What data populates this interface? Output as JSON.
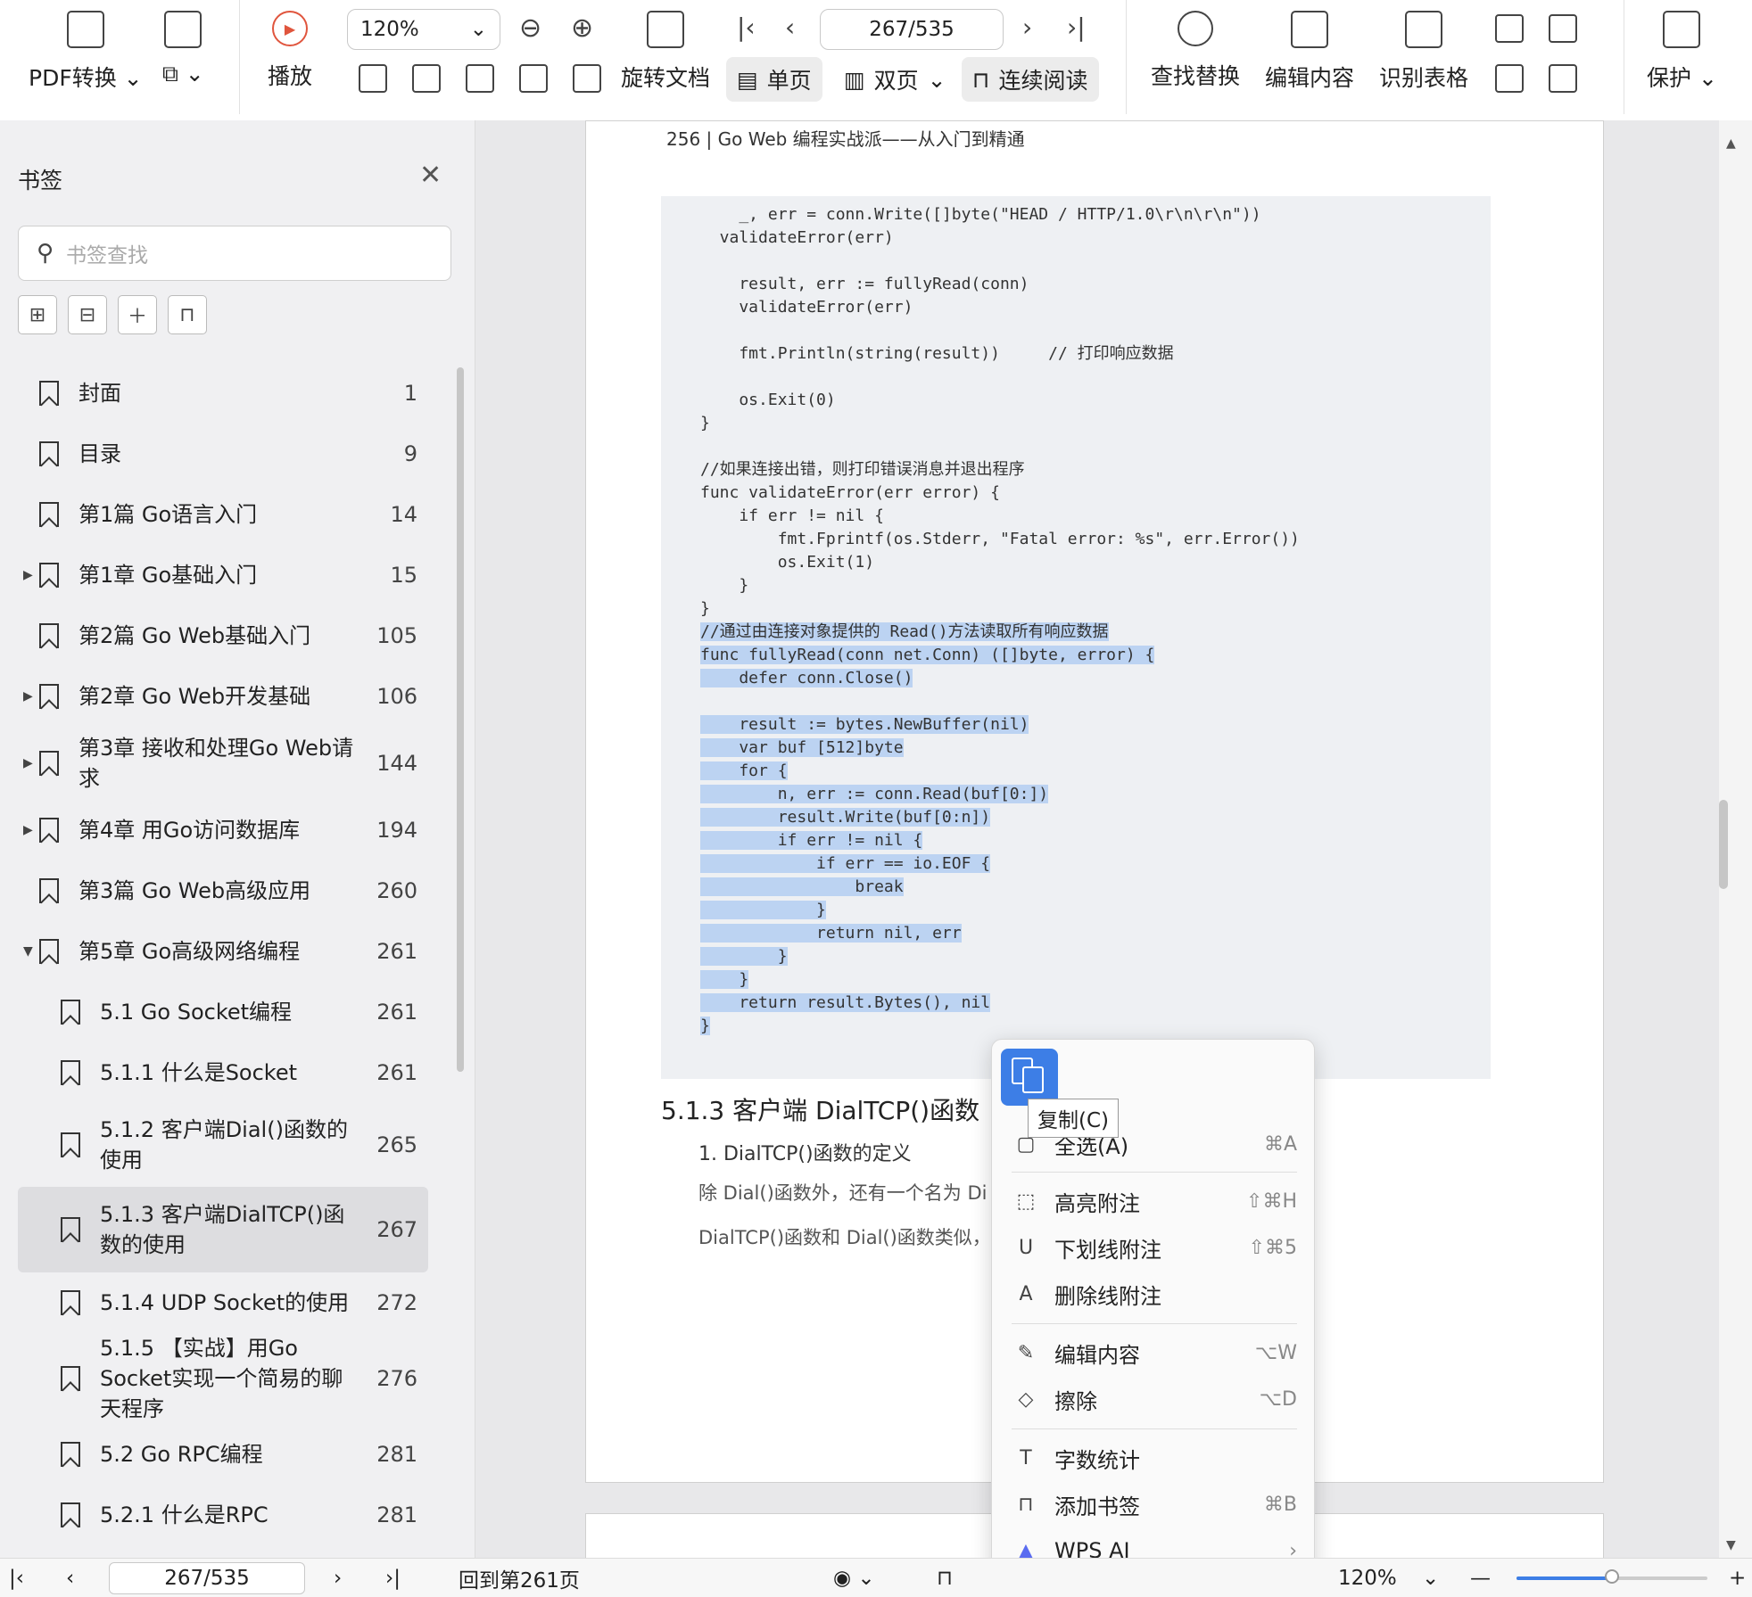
{
  "toolbar": {
    "pdf_convert": "PDF转换",
    "play": "播放",
    "zoom": "120%",
    "rotate_doc": "旋转文档",
    "page_indicator": "267/535",
    "single_page": "单页",
    "double_page": "双页",
    "continuous": "连续阅读",
    "find_replace": "查找替换",
    "edit_content": "编辑内容",
    "recognize_table": "识别表格",
    "protect": "保护"
  },
  "sidebar": {
    "title": "书签",
    "search_placeholder": "书签查找",
    "items": [
      {
        "label": "封面",
        "page": "1"
      },
      {
        "label": "目录",
        "page": "9"
      },
      {
        "label": "第1篇 Go语言入门",
        "page": "14"
      },
      {
        "label": "第1章 Go基础入门",
        "page": "15"
      },
      {
        "label": "第2篇 Go Web基础入门",
        "page": "105"
      },
      {
        "label": "第2章 Go Web开发基础",
        "page": "106"
      },
      {
        "label": "第3章 接收和处理Go Web请求",
        "page": "144"
      },
      {
        "label": "第4章 用Go访问数据库",
        "page": "194"
      },
      {
        "label": "第3篇 Go Web高级应用",
        "page": "260"
      },
      {
        "label": "第5章 Go高级网络编程",
        "page": "261"
      },
      {
        "label": "5.1 Go Socket编程",
        "page": "261"
      },
      {
        "label": "5.1.1 什么是Socket",
        "page": "261"
      },
      {
        "label": "5.1.2 客户端Dial()函数的使用",
        "page": "265"
      },
      {
        "label": "5.1.3 客户端DialTCP()函数的使用",
        "page": "267"
      },
      {
        "label": "5.1.4 UDP Socket的使用",
        "page": "272"
      },
      {
        "label": "5.1.5 【实战】用Go Socket实现一个简易的聊天程序",
        "page": "276"
      },
      {
        "label": "5.2 Go RPC编程",
        "page": "281"
      },
      {
        "label": "5.2.1 什么是RPC",
        "page": "281"
      }
    ]
  },
  "document": {
    "page_header": "256 | Go Web 编程实战派——从入门到精通",
    "code_plain": "    _, err = conn.Write([]byte(\"HEAD / HTTP/1.0\\r\\n\\r\\n\"))\n  validateError(err)\n\n    result, err := fullyRead(conn)\n    validateError(err)\n\n    fmt.Println(string(result))     // 打印响应数据\n\n    os.Exit(0)\n}\n\n//如果连接出错，则打印错误消息并退出程序\nfunc validateError(err error) {\n    if err != nil {\n        fmt.Fprintf(os.Stderr, \"Fatal error: %s\", err.Error())\n        os.Exit(1)\n    }\n}\n",
    "code_selected": "//通过由连接对象提供的 Read()方法读取所有响应数据\nfunc fullyRead(conn net.Conn) ([]byte, error) {\n    defer conn.Close()\n\n    result := bytes.NewBuffer(nil)\n    var buf [512]byte\n    for {\n        n, err := conn.Read(buf[0:])\n        result.Write(buf[0:n])\n        if err != nil {\n            if err == io.EOF {\n                break\n            }\n            return nil, err\n        }\n    }\n    return result.Bytes(), nil\n}",
    "section_heading": "5.1.3  客户端 DialTCP()函数",
    "subsection": "1. DialTCP()函数的定义",
    "para1": "除 Dial()函数外，还有一个名为 Di",
    "para2": "DialTCP()函数和 Dial()函数类似，"
  },
  "context_menu": {
    "copy_tooltip": "复制(C)",
    "select_all": "全选(A)",
    "select_all_shortcut": "⌘A",
    "items": [
      {
        "label": "高亮附注",
        "shortcut": "⇧⌘H"
      },
      {
        "label": "下划线附注",
        "shortcut": "⇧⌘5"
      },
      {
        "label": "删除线附注",
        "shortcut": ""
      },
      {
        "label": "编辑内容",
        "shortcut": "⌥W"
      },
      {
        "label": "擦除",
        "shortcut": "⌥D"
      },
      {
        "label": "字数统计",
        "shortcut": ""
      },
      {
        "label": "添加书签",
        "shortcut": "⌘B"
      },
      {
        "label": "WPS AI",
        "shortcut": "›"
      }
    ]
  },
  "status_bar": {
    "page_input": "267/535",
    "back_to_page": "回到第261页",
    "zoom": "120%",
    "zoom_level": 0.5
  }
}
